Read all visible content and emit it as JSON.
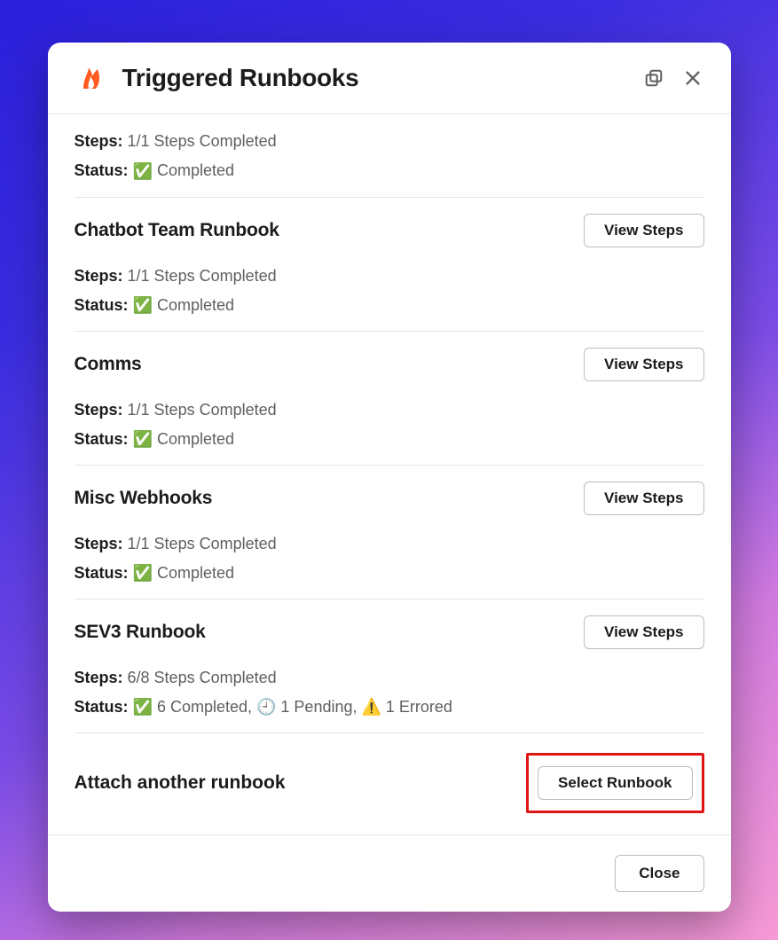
{
  "header": {
    "title": "Triggered Runbooks"
  },
  "labels": {
    "steps": "Steps:",
    "status": "Status:",
    "view_steps": "View Steps",
    "select_runbook": "Select Runbook",
    "close": "Close"
  },
  "top_partial": {
    "steps_value": "1/1 Steps Completed",
    "status_icon": "✅",
    "status_value": "Completed"
  },
  "runbooks": [
    {
      "title": "Chatbot Team Runbook",
      "steps_value": "1/1 Steps Completed",
      "status_text": "✅ Completed"
    },
    {
      "title": "Comms",
      "steps_value": "1/1 Steps Completed",
      "status_text": "✅ Completed"
    },
    {
      "title": "Misc Webhooks",
      "steps_value": "1/1 Steps Completed",
      "status_text": "✅ Completed"
    },
    {
      "title": "SEV3 Runbook",
      "steps_value": "6/8 Steps Completed",
      "status_text": "✅ 6 Completed, 🕘 1 Pending, ⚠️ 1 Errored"
    }
  ],
  "attach": {
    "title": "Attach another runbook"
  }
}
